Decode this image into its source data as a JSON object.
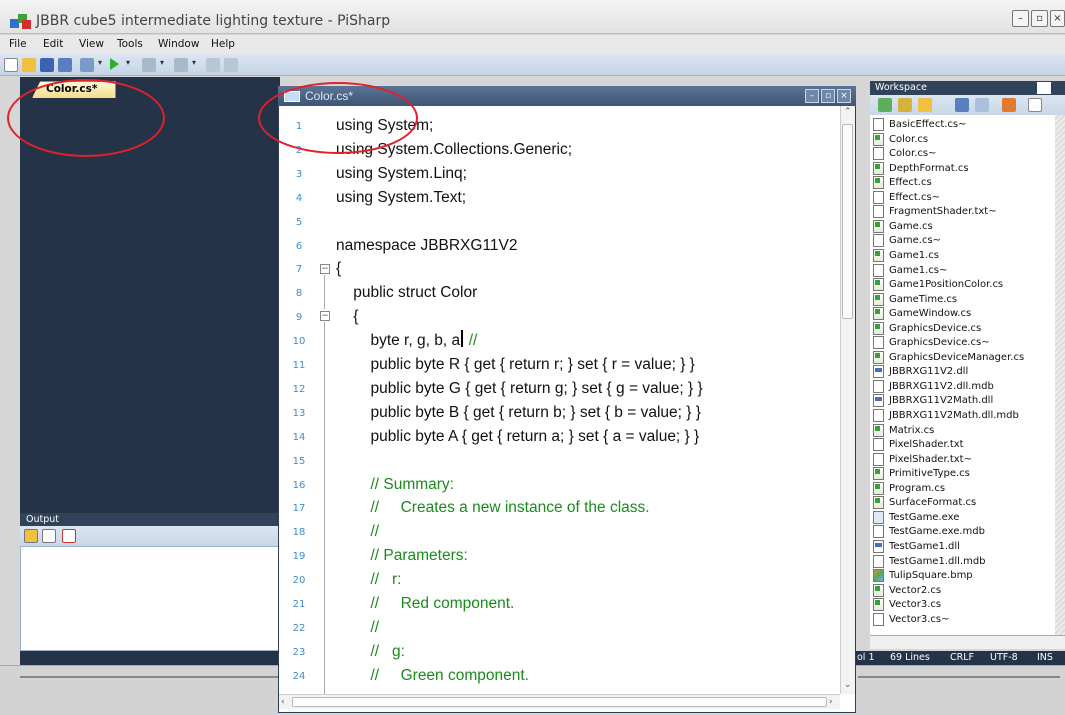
{
  "window": {
    "title": "JBBR cube5 intermediate lighting texture - PiSharp",
    "min": "–",
    "max": "▫",
    "close": "×"
  },
  "menu": [
    "File",
    "Edit",
    "View",
    "Tools",
    "Window",
    "Help"
  ],
  "left_doc": {
    "tab_label": "Color.cs*"
  },
  "output": {
    "title": "Output"
  },
  "editor": {
    "title": "Color.cs*",
    "lines": [
      {
        "n": "1",
        "code": "using System;",
        "comment": ""
      },
      {
        "n": "2",
        "code": "using System.Collections.Generic;",
        "comment": ""
      },
      {
        "n": "3",
        "code": "using System.Linq;",
        "comment": ""
      },
      {
        "n": "4",
        "code": "using System.Text;",
        "comment": ""
      },
      {
        "n": "5",
        "code": "",
        "comment": ""
      },
      {
        "n": "6",
        "code": "namespace JBBRXG11V2",
        "comment": ""
      },
      {
        "n": "7",
        "code": "{",
        "comment": ""
      },
      {
        "n": "8",
        "code": "    public struct Color",
        "comment": ""
      },
      {
        "n": "9",
        "code": "    {",
        "comment": ""
      },
      {
        "n": "10",
        "code": "        byte r, g, b, a; ",
        "comment": "//"
      },
      {
        "n": "11",
        "code": "        public byte R { get { return r; } set { r = value; } }",
        "comment": ""
      },
      {
        "n": "12",
        "code": "        public byte G { get { return g; } set { g = value; } }",
        "comment": ""
      },
      {
        "n": "13",
        "code": "        public byte B { get { return b; } set { b = value; } }",
        "comment": ""
      },
      {
        "n": "14",
        "code": "        public byte A { get { return a; } set { a = value; } }",
        "comment": ""
      },
      {
        "n": "15",
        "code": "",
        "comment": ""
      },
      {
        "n": "16",
        "code": "",
        "comment": "        // Summary:"
      },
      {
        "n": "17",
        "code": "",
        "comment": "        //     Creates a new instance of the class."
      },
      {
        "n": "18",
        "code": "",
        "comment": "        //"
      },
      {
        "n": "19",
        "code": "",
        "comment": "        // Parameters:"
      },
      {
        "n": "20",
        "code": "",
        "comment": "        //   r:"
      },
      {
        "n": "21",
        "code": "",
        "comment": "        //     Red component."
      },
      {
        "n": "22",
        "code": "",
        "comment": "        //"
      },
      {
        "n": "23",
        "code": "",
        "comment": "        //   g:"
      },
      {
        "n": "24",
        "code": "",
        "comment": "        //     Green component."
      }
    ]
  },
  "workspace": {
    "title": "Workspace",
    "files": [
      {
        "name": "BasicEffect.cs~",
        "type": "txt"
      },
      {
        "name": "Color.cs",
        "type": "cs"
      },
      {
        "name": "Color.cs~",
        "type": "txt"
      },
      {
        "name": "DepthFormat.cs",
        "type": "cs"
      },
      {
        "name": "Effect.cs",
        "type": "cs"
      },
      {
        "name": "Effect.cs~",
        "type": "txt"
      },
      {
        "name": "FragmentShader.txt~",
        "type": "txt"
      },
      {
        "name": "Game.cs",
        "type": "cs"
      },
      {
        "name": "Game.cs~",
        "type": "txt"
      },
      {
        "name": "Game1.cs",
        "type": "cs"
      },
      {
        "name": "Game1.cs~",
        "type": "txt"
      },
      {
        "name": "Game1PositionColor.cs",
        "type": "cs"
      },
      {
        "name": "GameTime.cs",
        "type": "cs"
      },
      {
        "name": "GameWindow.cs",
        "type": "cs"
      },
      {
        "name": "GraphicsDevice.cs",
        "type": "cs"
      },
      {
        "name": "GraphicsDevice.cs~",
        "type": "txt"
      },
      {
        "name": "GraphicsDeviceManager.cs",
        "type": "cs"
      },
      {
        "name": "JBBRXG11V2.dll",
        "type": "dll"
      },
      {
        "name": "JBBRXG11V2.dll.mdb",
        "type": "txt"
      },
      {
        "name": "JBBRXG11V2Math.dll",
        "type": "dll"
      },
      {
        "name": "JBBRXG11V2Math.dll.mdb",
        "type": "txt"
      },
      {
        "name": "Matrix.cs",
        "type": "cs"
      },
      {
        "name": "PixelShader.txt",
        "type": "txt"
      },
      {
        "name": "PixelShader.txt~",
        "type": "txt"
      },
      {
        "name": "PrimitiveType.cs",
        "type": "cs"
      },
      {
        "name": "Program.cs",
        "type": "cs"
      },
      {
        "name": "SurfaceFormat.cs",
        "type": "cs"
      },
      {
        "name": "TestGame.exe",
        "type": "exe"
      },
      {
        "name": "TestGame.exe.mdb",
        "type": "txt"
      },
      {
        "name": "TestGame1.dll",
        "type": "dll"
      },
      {
        "name": "TestGame1.dll.mdb",
        "type": "txt"
      },
      {
        "name": "TulipSquare.bmp",
        "type": "bmp"
      },
      {
        "name": "Vector2.cs",
        "type": "cs"
      },
      {
        "name": "Vector3.cs",
        "type": "cs"
      },
      {
        "name": "Vector3.cs~",
        "type": "txt"
      }
    ]
  },
  "status": {
    "col": "ol 1",
    "lines": "69 Lines",
    "eol": "CRLF",
    "encoding": "UTF-8",
    "mode": "INS"
  },
  "colors": {
    "annotation": "#e0202a",
    "comment": "#1c8a1c",
    "line_number": "#3b8ccf",
    "dock_dark": "#243347"
  }
}
